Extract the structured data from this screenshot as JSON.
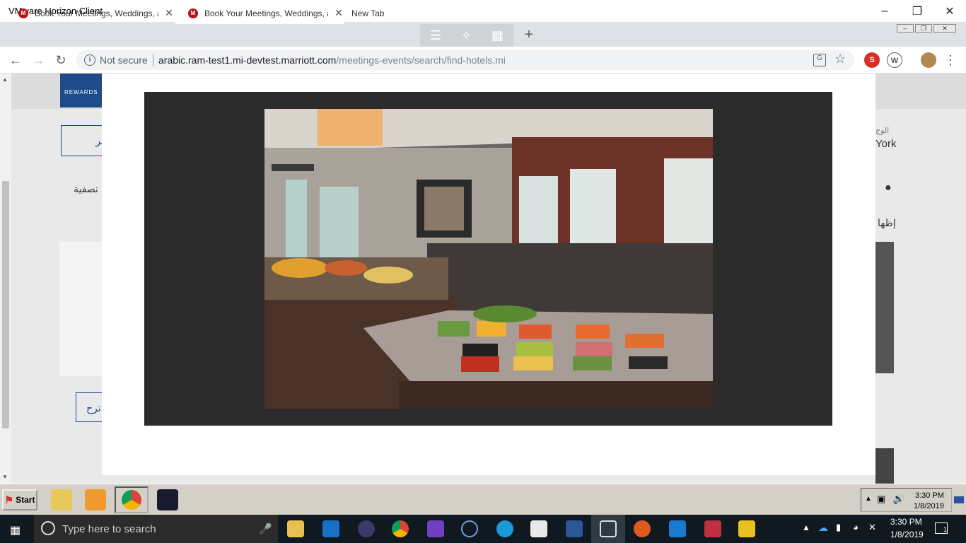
{
  "window": {
    "title": "VMware Horizon Client"
  },
  "browser": {
    "tabs": [
      {
        "title": "Book Your Meetings, Weddings, and",
        "active": false
      },
      {
        "title": "Book Your Meetings, Weddings, and",
        "active": true
      },
      {
        "title": "New Tab",
        "active": false
      }
    ],
    "security_label": "Not secure",
    "url_host": "arabic.ram-test1.mi-devtest.marriott.com",
    "url_path": "/meetings-events/search/find-hotels.mi",
    "extension_labels": [
      "S",
      "W"
    ]
  },
  "background_page": {
    "filter_label": "تصفية",
    "show_label": "إظها",
    "btn_fragment": "ير",
    "propose_fragment": "ترح",
    "dest_fragment": "الوج",
    "city_fragment": "York",
    "brand": "REWARDS"
  },
  "gallery": {
    "image": "hotel-buffet-restaurant-photo"
  },
  "vm_taskbar": {
    "start_label": "Start",
    "time": "3:30 PM",
    "date": "1/8/2019"
  },
  "win_taskbar": {
    "search_placeholder": "Type here to search",
    "time": "3:30 PM",
    "date": "1/8/2019",
    "notification_count": "1"
  },
  "colors": {
    "accent": "#b5121b",
    "page_bg": "#e9e9e9",
    "gallery_bg": "#2b2b2b"
  }
}
